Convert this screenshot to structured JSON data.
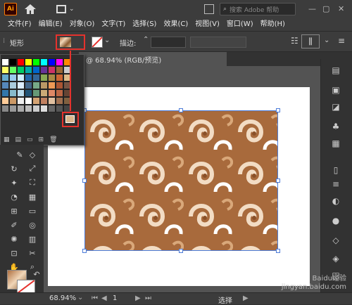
{
  "app": {
    "logo": "Ai"
  },
  "search": {
    "placeholder": "搜索 Adobe 帮助"
  },
  "menu": [
    "文件(F)",
    "编辑(E)",
    "对象(O)",
    "文字(T)",
    "选择(S)",
    "效果(C)",
    "视图(V)",
    "窗口(W)",
    "帮助(H)"
  ],
  "control": {
    "object_type": "矩形",
    "stroke_label": "描边:"
  },
  "document": {
    "tab_title": "@ 68.94% (RGB/预览)"
  },
  "status": {
    "zoom": "68.94%",
    "artboard": "1",
    "mode": "选择"
  },
  "watermark": {
    "line1": "Baidu经验",
    "line2": "jingyan.baidu.com"
  },
  "colors": {
    "accent_red": "#e5322d",
    "selection_blue": "#4b7bd8",
    "pattern_brown": "#a86a3c"
  },
  "swatches": [
    "#ffffff",
    "#000000",
    "#ff0000",
    "#ffff00",
    "#00ff00",
    "#00ffff",
    "#0000ff",
    "#ff00ff",
    "#ff8800",
    "#ffff66",
    "#66ff66",
    "#00cc66",
    "#00aaaa",
    "#0066cc",
    "#663399",
    "#cc3366",
    "#996633",
    "#cccccc",
    "#66aacc",
    "#99ccee",
    "#cceeff",
    "#2266aa",
    "#336699",
    "#88aa55",
    "#aa8844",
    "#cc6633",
    "#ddbb88",
    "#5588bb",
    "#aaccdd",
    "#ddeeff",
    "#446688",
    "#77aa88",
    "#bb9966",
    "#ee9955",
    "#aa5533",
    "#775544",
    "#3377aa",
    "#88bbcc",
    "#bbddee",
    "#225577",
    "#669977",
    "#ccaa77",
    "#dd8866",
    "#bb6644",
    "#664433",
    "#ffcc99",
    "#cc9966",
    "#eeeeee",
    "#ffffff",
    "#d4a373",
    "#c08060",
    "#e0c0a0",
    "#a07050",
    "#806040",
    "#888888",
    "#999999",
    "#aaaaaa",
    "#bbbbbb",
    "#cccccc",
    "#dddddd",
    "#666666",
    "#555555",
    "#444444"
  ]
}
